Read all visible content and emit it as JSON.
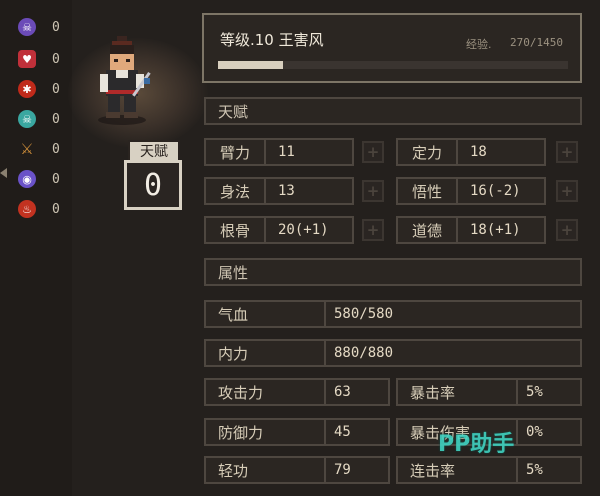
{
  "status_effects": [
    {
      "icon": "skull-icon",
      "color": "#6b4bb8",
      "value": "0"
    },
    {
      "icon": "broken-heart-icon",
      "color": "#c0303a",
      "value": "0"
    },
    {
      "icon": "bug-icon",
      "color": "#c02a1a",
      "value": "0"
    },
    {
      "icon": "poison-skull-icon",
      "color": "#3aa7a0",
      "value": "0"
    },
    {
      "icon": "sword-icon",
      "color": "#c88a38",
      "value": "0"
    },
    {
      "icon": "mask-icon",
      "color": "#6a52c8",
      "value": "0"
    },
    {
      "icon": "flame-icon",
      "color": "#c23220",
      "value": "0"
    }
  ],
  "talent_points": {
    "label": "天赋",
    "value": "0"
  },
  "header": {
    "title": "等级.10 王害风",
    "exp_label": "经验.",
    "exp_value": "270/1450",
    "exp_progress": 0.186
  },
  "sections": {
    "talent": "天赋",
    "attributes": "属性"
  },
  "talent_attributes": [
    {
      "name": "臂力",
      "value": "11"
    },
    {
      "name": "定力",
      "value": "18"
    },
    {
      "name": "身法",
      "value": "13"
    },
    {
      "name": "悟性",
      "value": "16(-2)"
    },
    {
      "name": "根骨",
      "value": "20(+1)"
    },
    {
      "name": "道德",
      "value": "18(+1)"
    }
  ],
  "stats_full": [
    {
      "name": "气血",
      "value": "580/580"
    },
    {
      "name": "内力",
      "value": "880/880"
    }
  ],
  "stats_pairs": [
    {
      "left_name": "攻击力",
      "left_value": "63",
      "right_name": "暴击率",
      "right_value": "5%"
    },
    {
      "left_name": "防御力",
      "left_value": "45",
      "right_name": "暴击伤害",
      "right_value": "0%"
    },
    {
      "left_name": "轻功",
      "left_value": "79",
      "right_name": "连击率",
      "right_value": "5%"
    }
  ],
  "plus_symbol": "+",
  "watermark": "PP助手"
}
